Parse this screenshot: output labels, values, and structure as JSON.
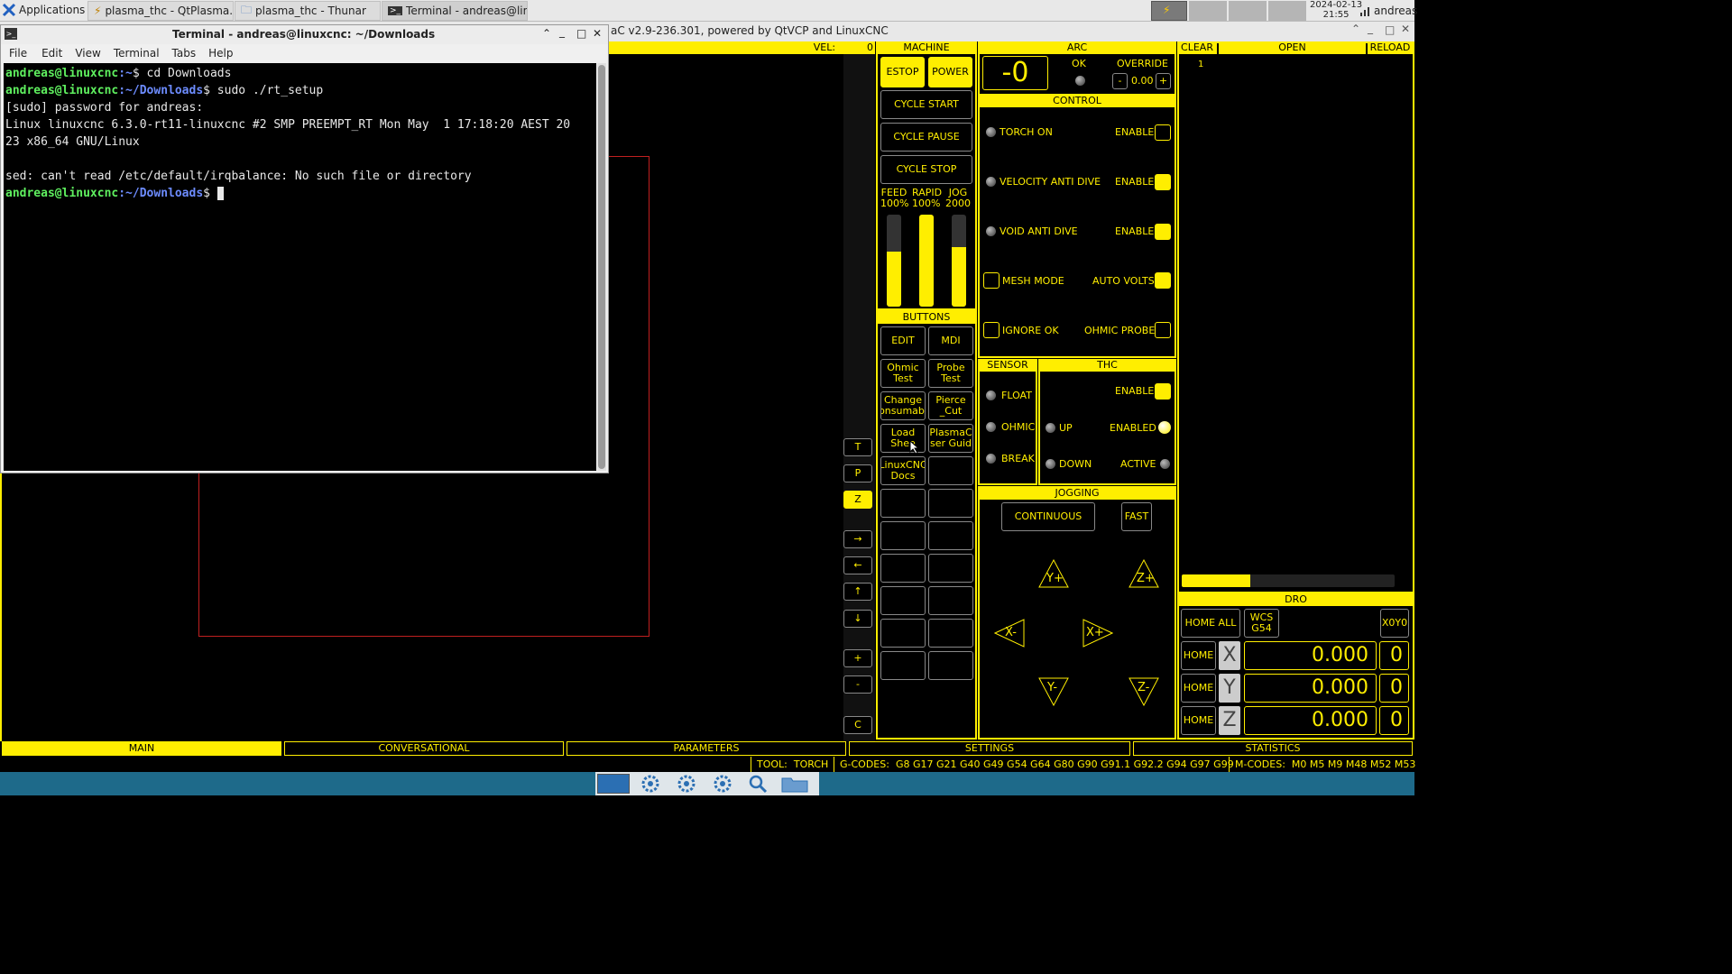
{
  "taskbar": {
    "apps_label": "Applications",
    "tasks": [
      "plasma_thc - QtPlasma...",
      "plasma_thc - Thunar",
      "Terminal - andreas@lin..."
    ],
    "date": "2024-02-13",
    "time": "21:55",
    "user": "andreas"
  },
  "qtplasma": {
    "title_fragment": "aC v2.9-236.301, powered by QtVCP and LinuxCNC",
    "vel_label": "VEL:",
    "vel_value": "0",
    "side_buttons": [
      "T",
      "P",
      "Z",
      "→",
      "←",
      "↑",
      "↓",
      "+",
      "-",
      "C"
    ],
    "machine": {
      "header": "MACHINE",
      "estop": "ESTOP",
      "power": "POWER",
      "cycle_start": "CYCLE START",
      "cycle_pause": "CYCLE PAUSE",
      "cycle_stop": "CYCLE STOP",
      "sliders": [
        {
          "label": "FEED",
          "value": "100%",
          "fill": 0.6
        },
        {
          "label": "RAPID",
          "value": "100%",
          "fill": 1.0
        },
        {
          "label": "JOG",
          "value": "2000",
          "fill": 0.65
        }
      ]
    },
    "buttons_panel": {
      "header": "BUTTONS",
      "edit": "EDIT",
      "mdi": "MDI",
      "ohmic_test": "Ohmic Test",
      "probe_test": "Probe Test",
      "change_consumable": "Change onsumabl",
      "pierce_cut": "Pierce _Cut",
      "load_sheet": "Load Shee",
      "plasmac_guide": "PlasmaC ser Guid",
      "linuxcnc_docs": "LinuxCNC Docs"
    },
    "arc": {
      "header": "ARC",
      "voltage": "-0",
      "ok_label": "OK",
      "override_label": "OVERRIDE",
      "override_minus": "-",
      "override_value": "0.00",
      "override_plus": "+"
    },
    "control": {
      "header": "CONTROL",
      "torch_on": "TORCH ON",
      "velocity_anti_dive": "VELOCITY ANTI DIVE",
      "void_anti_dive": "VOID ANTI DIVE",
      "enable": "ENABLE",
      "mesh_mode": "MESH MODE",
      "auto_volts": "AUTO VOLTS",
      "ignore_ok": "IGNORE OK",
      "ohmic_probe": "OHMIC PROBE"
    },
    "sensor": {
      "header": "SENSOR",
      "float": "FLOAT",
      "ohmic": "OHMIC",
      "break": "BREAK"
    },
    "thc": {
      "header": "THC",
      "enable": "ENABLE",
      "up": "UP",
      "enabled": "ENABLED",
      "down": "DOWN",
      "active": "ACTIVE"
    },
    "jogging": {
      "header": "JOGGING",
      "continuous": "CONTINUOUS",
      "fast": "FAST",
      "y_plus": "Y+",
      "z_plus": "Z+",
      "x_minus": "X-",
      "x_plus": "X+",
      "y_minus": "Y-",
      "z_minus": "Z-"
    },
    "gcode": {
      "clear": "CLEAR",
      "open": "OPEN",
      "reload": "RELOAD",
      "line1": "1",
      "progress": 0.32
    },
    "dro": {
      "header": "DRO",
      "home_all": "HOME ALL",
      "wcs": "WCS G54",
      "x0y0": "X0Y0",
      "home": "HOME",
      "axes": [
        {
          "axis": "X",
          "value": "0.000",
          "spin": "0"
        },
        {
          "axis": "Y",
          "value": "0.000",
          "spin": "0"
        },
        {
          "axis": "Z",
          "value": "0.000",
          "spin": "0"
        }
      ]
    },
    "tabs": [
      "MAIN",
      "CONVERSATIONAL",
      "PARAMETERS",
      "SETTINGS",
      "STATISTICS"
    ],
    "status": {
      "tool_label": "TOOL:",
      "tool_value": "TORCH",
      "gcodes_label": "G-CODES:",
      "gcodes_value": "G8 G17 G21 G40 G49 G54 G64 G80 G90 G91.1 G92.2 G94 G97 G99",
      "mcodes_label": "M-CODES:",
      "mcodes_value": "M0 M5 M9 M48 M52 M53"
    }
  },
  "terminal": {
    "title": "Terminal - andreas@linuxcnc: ~/Downloads",
    "menu": [
      "File",
      "Edit",
      "View",
      "Terminal",
      "Tabs",
      "Help"
    ],
    "user_host": "andreas@linuxcnc",
    "lines": [
      {
        "path": ":~",
        "cmd": "$ cd Downloads"
      },
      {
        "path": ":~/Downloads",
        "cmd": "$ sudo ./rt_setup"
      }
    ],
    "output": [
      "[sudo] password for andreas:",
      "Linux linuxcnc 6.3.0-rt11-linuxcnc #2 SMP PREEMPT_RT Mon May  1 17:18:20 AEST 20",
      "23 x86_64 GNU/Linux",
      "",
      "sed: can't read /etc/default/irqbalance: No such file or directory"
    ],
    "prompt_path": ":~/Downloads",
    "prompt_symbol": "$ "
  }
}
